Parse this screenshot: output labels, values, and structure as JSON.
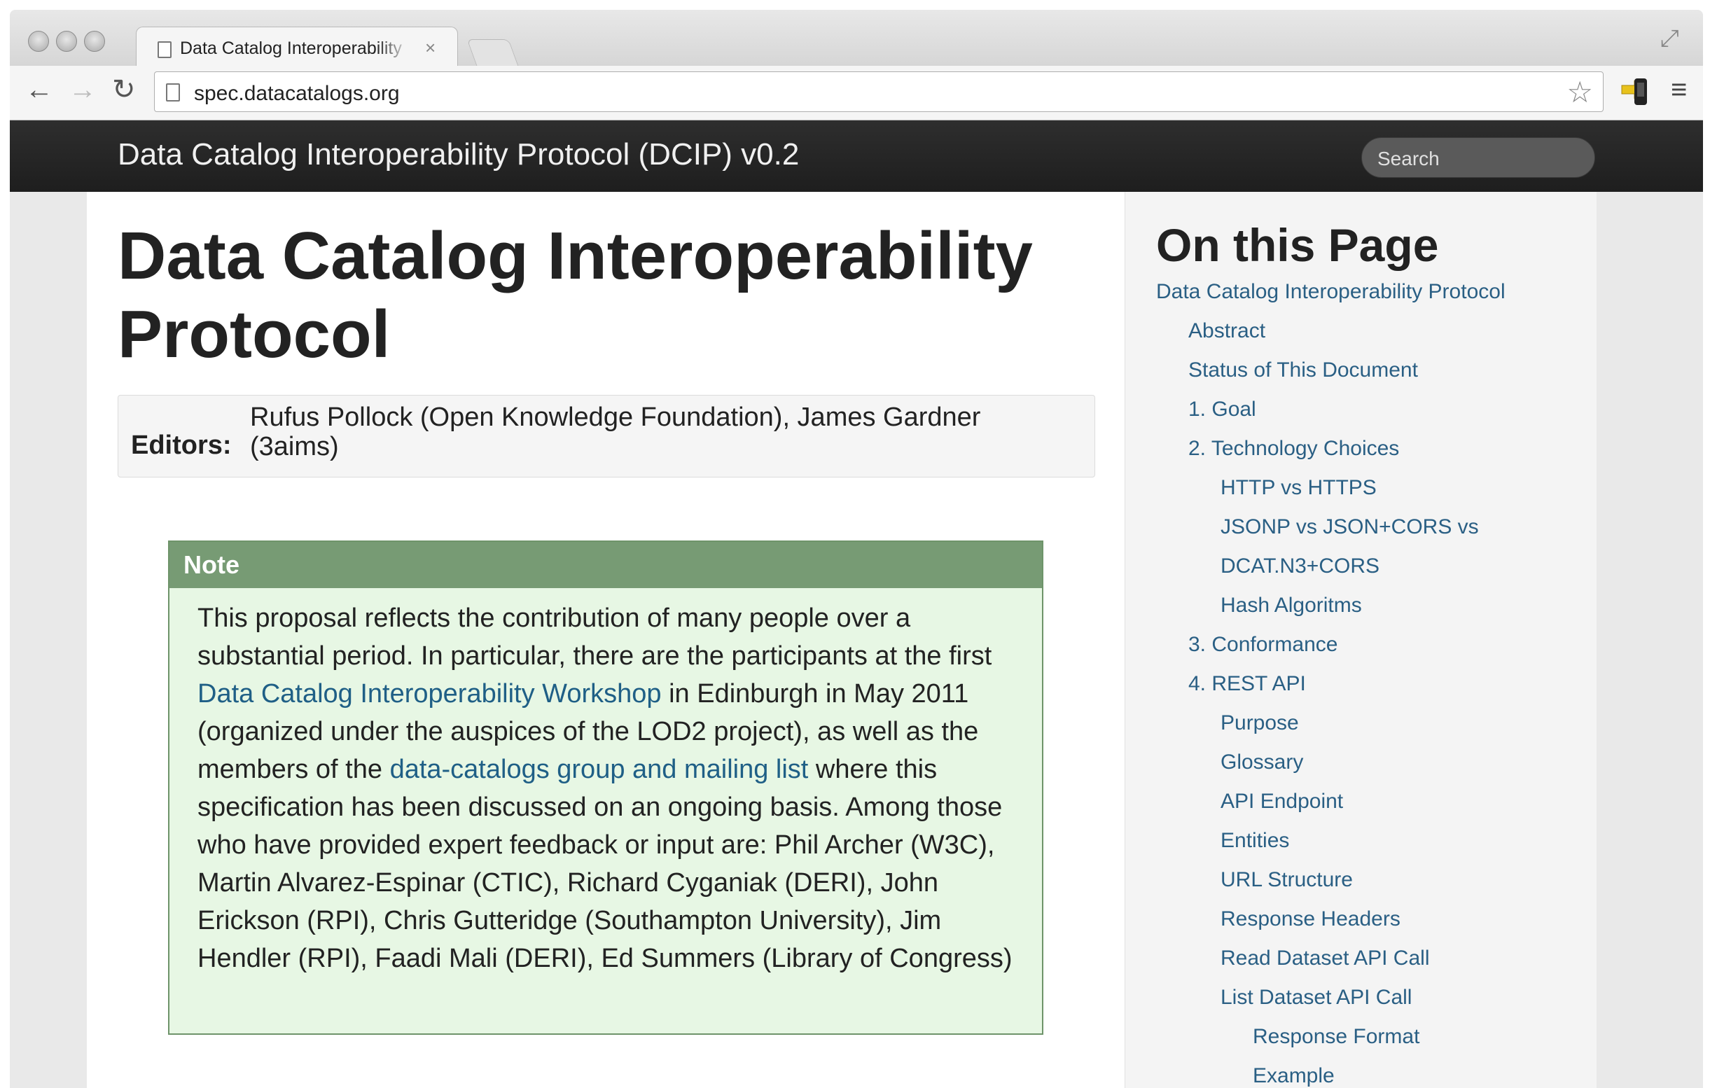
{
  "browser": {
    "tab_title": "Data Catalog Interoperability",
    "tab_close": "×",
    "url": "spec.datacatalogs.org"
  },
  "navbar": {
    "brand": "Data Catalog Interoperability Protocol (DCIP) v0.2",
    "search_placeholder": "Search"
  },
  "main": {
    "title": "Data Catalog Interoperability Protocol",
    "editors_label": "Editors:",
    "editors_value": "Rufus Pollock (Open Knowledge Foundation), James Gardner (3aims)",
    "note": {
      "heading": "Note",
      "text_1": "This proposal reflects the contribution of many people over a substantial period. In particular, there are the participants at the first ",
      "link_1": "Data Catalog Interoperability Workshop",
      "text_2": " in Edinburgh in May 2011 (organized under the auspices of the LOD2 project), as well as the members of the ",
      "link_2": "data-catalogs group and mailing list",
      "text_3": " where this specification has been discussed on an ongoing basis. Among those who have provided expert feedback or input are: Phil Archer (W3C), Martin Alvarez-Espinar (CTIC), Richard Cyganiak (DERI), John Erickson (RPI), Chris Gutteridge (Southampton University), Jim Hendler (RPI), Faadi Mali (DERI), Ed Summers (Library of Congress)"
    }
  },
  "toc": {
    "title": "On this Page",
    "items": [
      {
        "label": "Data Catalog Interoperability Protocol",
        "level": 0
      },
      {
        "label": "Abstract",
        "level": 1
      },
      {
        "label": "Status of This Document",
        "level": 1
      },
      {
        "label": "1. Goal",
        "level": 1
      },
      {
        "label": "2. Technology Choices",
        "level": 1
      },
      {
        "label": "HTTP vs HTTPS",
        "level": 2
      },
      {
        "label": "JSONP vs JSON+CORS vs",
        "level": 2
      },
      {
        "label": "DCAT.N3+CORS",
        "level": 2
      },
      {
        "label": "Hash Algoritms",
        "level": 2
      },
      {
        "label": "3. Conformance",
        "level": 1
      },
      {
        "label": "4. REST API",
        "level": 1
      },
      {
        "label": "Purpose",
        "level": 2
      },
      {
        "label": "Glossary",
        "level": 2
      },
      {
        "label": "API Endpoint",
        "level": 2
      },
      {
        "label": "Entities",
        "level": 2
      },
      {
        "label": "URL Structure",
        "level": 2
      },
      {
        "label": "Response Headers",
        "level": 2
      },
      {
        "label": "Read Dataset API Call",
        "level": 2
      },
      {
        "label": "List Dataset API Call",
        "level": 2
      },
      {
        "label": "Response Format",
        "level": 3
      },
      {
        "label": "Example",
        "level": 3
      }
    ]
  }
}
